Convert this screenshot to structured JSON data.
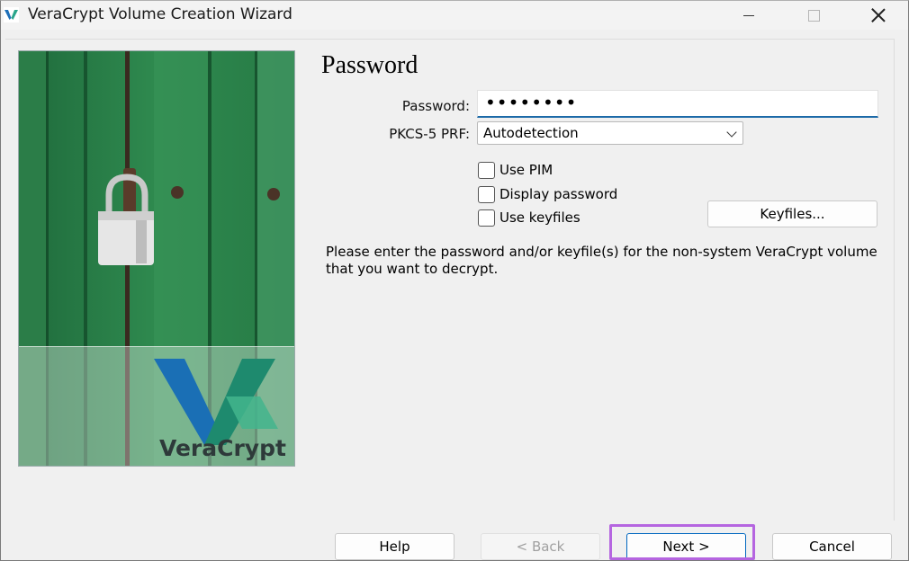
{
  "window": {
    "title": "VeraCrypt Volume Creation Wizard"
  },
  "side_image": {
    "logo_text": "VeraCrypt"
  },
  "page": {
    "title": "Password"
  },
  "form": {
    "password_label": "Password:",
    "password_value": "••••••••",
    "prf_label": "PKCS-5 PRF:",
    "prf_selected": "Autodetection",
    "checkboxes": [
      {
        "label": "Use PIM",
        "checked": false
      },
      {
        "label": "Display password",
        "checked": false
      },
      {
        "label": "Use keyfiles",
        "checked": false
      }
    ],
    "keyfiles_button": "Keyfiles..."
  },
  "info": {
    "text": "Please enter the password and/or keyfile(s) for the non-system VeraCrypt volume that you want to decrypt."
  },
  "buttons": {
    "help": "Help",
    "back": "< Back",
    "next": "Next >",
    "cancel": "Cancel"
  },
  "colors": {
    "accent": "#1c6aa8",
    "focus_highlight": "#b565e0",
    "door_green": "#2f8a4f"
  }
}
